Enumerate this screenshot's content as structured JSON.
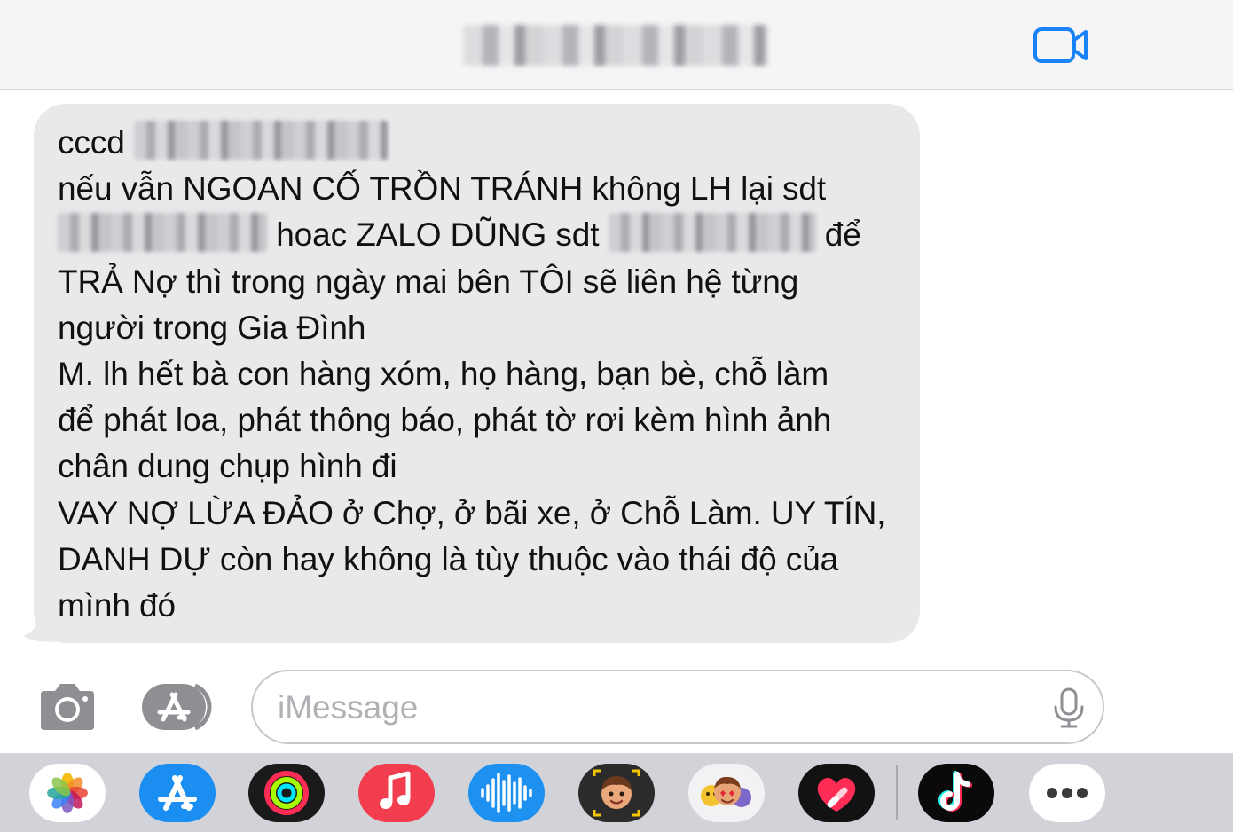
{
  "header": {
    "contact_name_blurred": true,
    "video_call_icon": "video-camera-icon",
    "accent_color": "#1a82f7"
  },
  "message": {
    "line1_prefix": "cccd",
    "line2": "nếu vẫn NGOAN CỐ TRỒN TRÁNH không LH lại sdt",
    "line3_mid": "hoac ZALO DŨNG sdt",
    "line3_suffix": "để",
    "line4": "TRẢ Nợ thì trong ngày mai bên TÔI sẽ liên hệ từng",
    "line5": "người trong Gia Đình",
    "line6": "M. lh hết bà con hàng xóm, họ hàng, bạn bè, chỗ làm",
    "line7": "để phát loa, phát thông báo, phát tờ rơi kèm hình ảnh",
    "line8": "chân dung chụp hình đi",
    "line9": "VAY NỢ LỪA ĐẢO ở Chợ, ở bãi xe, ở Chỗ Làm. UY TÍN,",
    "line10": "DANH DỰ còn hay không là tùy thuộc vào thái độ của",
    "line11": "mình đó",
    "bubble_color": "#e9e9eb"
  },
  "input_bar": {
    "placeholder": "iMessage",
    "value": "",
    "camera_icon": "camera-icon",
    "apps_icon": "app-store-icon",
    "mic_icon": "microphone-icon"
  },
  "app_drawer": {
    "apps": [
      {
        "name": "photos",
        "icon": "photos-icon"
      },
      {
        "name": "app-store",
        "icon": "app-store-icon"
      },
      {
        "name": "activity",
        "icon": "activity-rings-icon"
      },
      {
        "name": "music",
        "icon": "music-note-icon"
      },
      {
        "name": "audio-message",
        "icon": "waveform-icon"
      },
      {
        "name": "memoji",
        "icon": "memoji-icon"
      },
      {
        "name": "memoji-stickers",
        "icon": "memoji-stickers-icon"
      },
      {
        "name": "digital-touch",
        "icon": "heart-icon"
      },
      {
        "name": "tiktok",
        "icon": "tiktok-icon"
      },
      {
        "name": "more",
        "icon": "more-icon"
      }
    ]
  }
}
